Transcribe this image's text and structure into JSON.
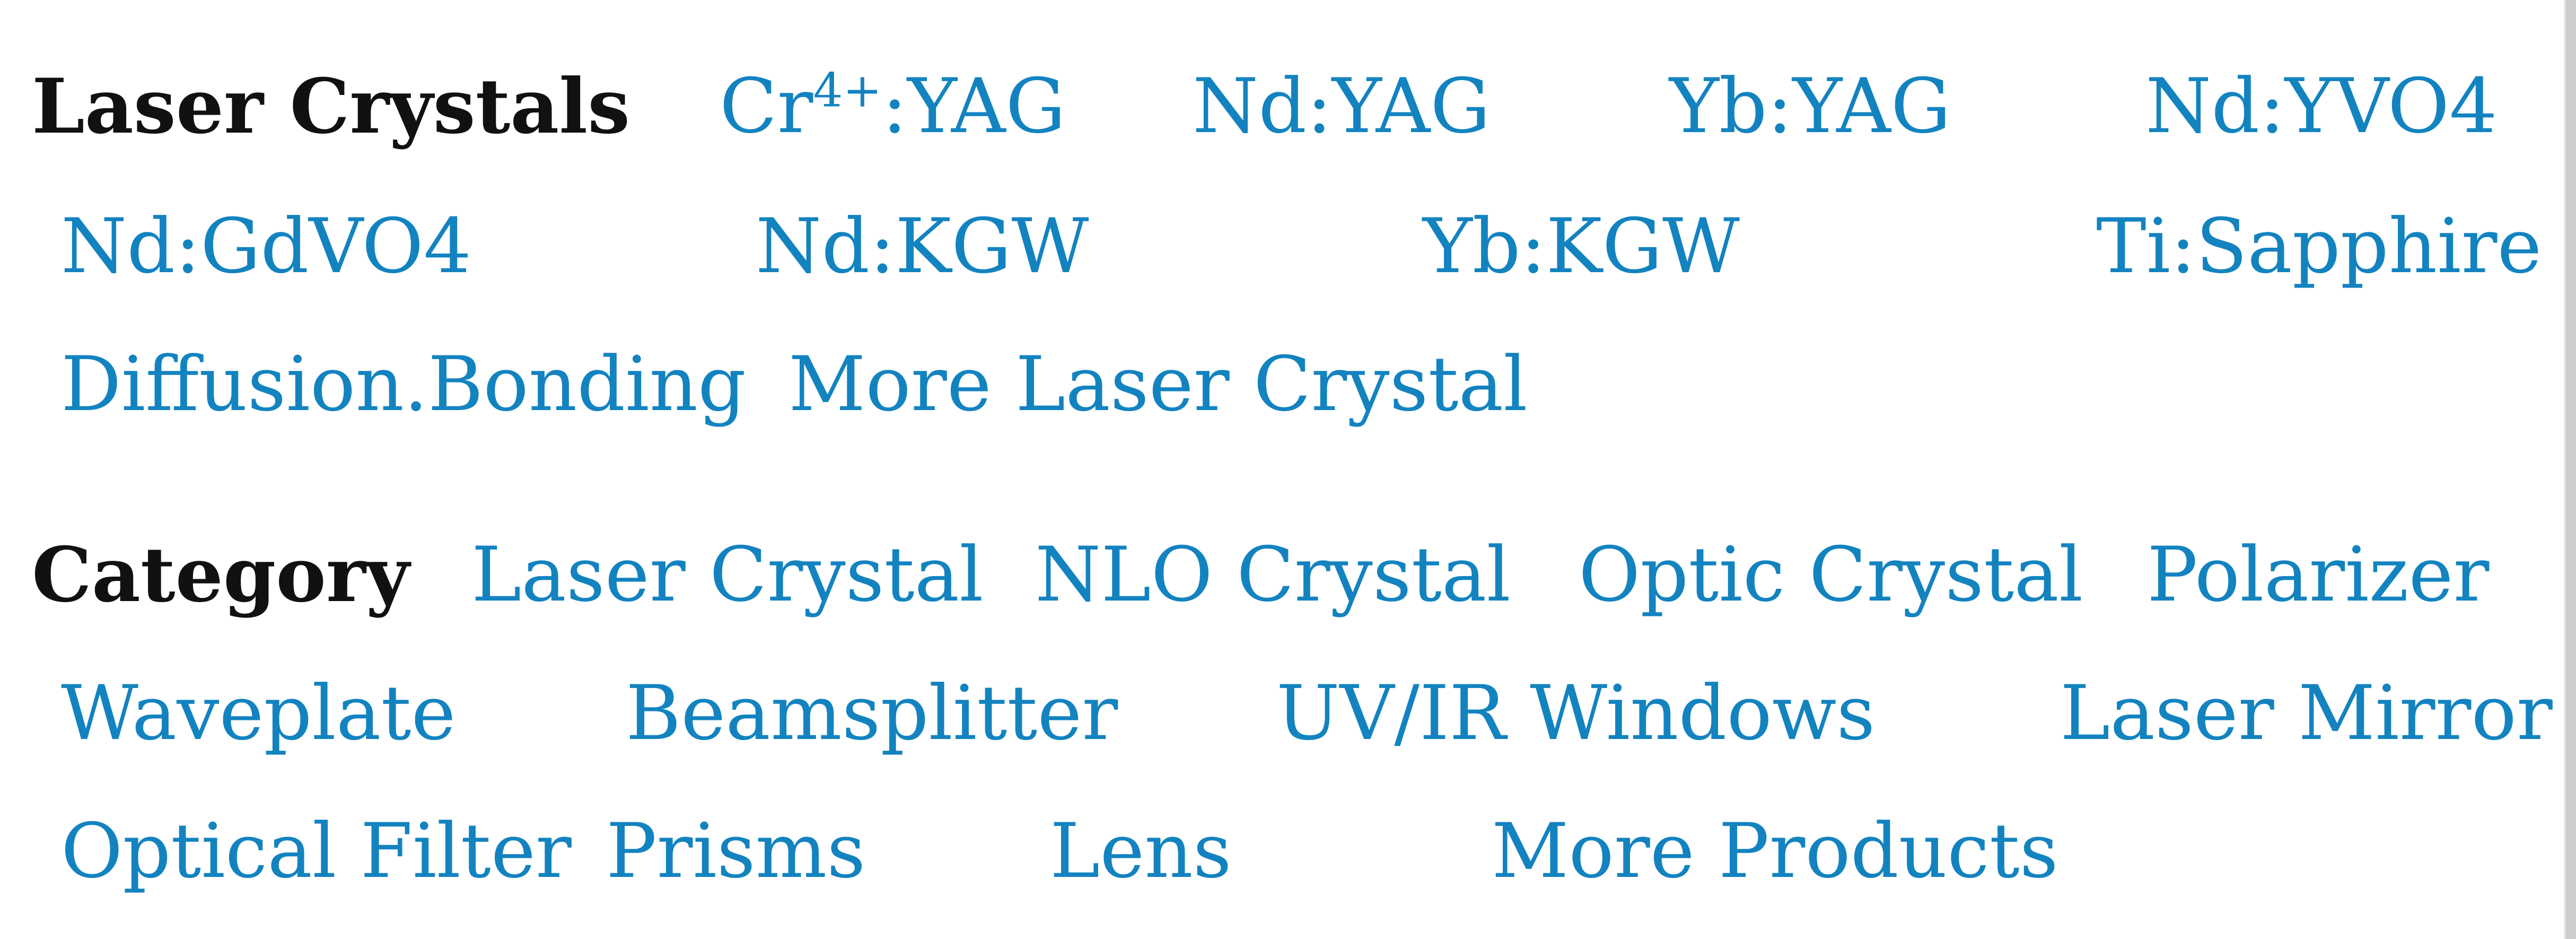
{
  "laser_crystals": {
    "heading": "Laser Crystals",
    "items": [
      {
        "label": "Cr",
        "sup": "4+",
        "suffix": ":YAG"
      },
      {
        "label": "Nd:YAG"
      },
      {
        "label": "Yb:YAG"
      },
      {
        "label": "Nd:YVO4"
      },
      {
        "label": "Nd:GdVO4"
      },
      {
        "label": "Nd:KGW"
      },
      {
        "label": "Yb:KGW"
      },
      {
        "label": "Ti:Sapphire"
      },
      {
        "label": "Diffusion.Bonding"
      },
      {
        "label": "More Laser Crystal"
      }
    ]
  },
  "category": {
    "heading": "Category",
    "items": [
      {
        "label": "Laser Crystal"
      },
      {
        "label": "NLO Crystal"
      },
      {
        "label": "Optic Crystal"
      },
      {
        "label": "Polarizer"
      },
      {
        "label": "Waveplate"
      },
      {
        "label": "Beamsplitter"
      },
      {
        "label": "UV/IR Windows"
      },
      {
        "label": "Laser Mirror"
      },
      {
        "label": "Optical Filter"
      },
      {
        "label": "Prisms"
      },
      {
        "label": "Lens"
      },
      {
        "label": "More Products"
      }
    ]
  },
  "colors": {
    "link": "#1383c0",
    "heading": "#111111"
  }
}
